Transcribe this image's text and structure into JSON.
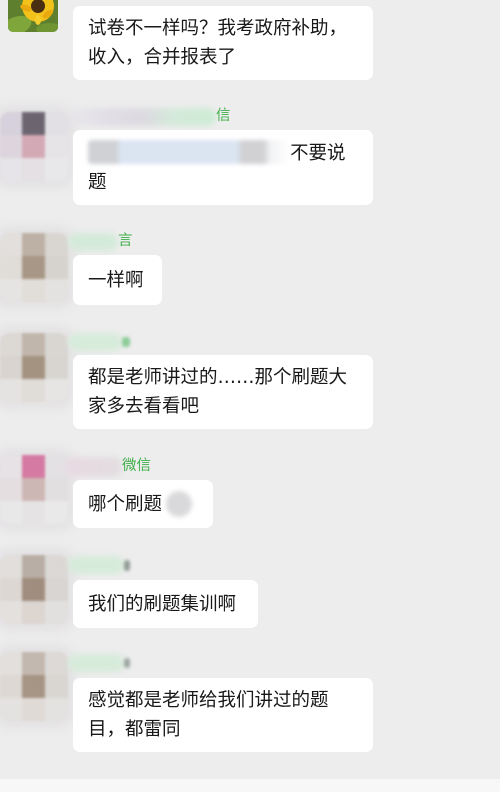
{
  "theme": {
    "background": "#EDEDED",
    "bubble": "#FFFFFF",
    "text": "#191919",
    "sender_tag": "#3FAE49",
    "bottom_bar": "#F7F7F7"
  },
  "messages": [
    {
      "lines": [
        "试卷不一样吗？我考政府补助，",
        "收入，合并报表了"
      ]
    },
    {
      "sender_tag": "信",
      "avatar_tiles": [
        "#D6D1DC",
        "#6C6570",
        "#E2E0E5",
        "#DDD4DD",
        "#D3A9B5",
        "#E6E4E7",
        "#E6E4E8",
        "#E4E0E3",
        "#E8E8EA"
      ],
      "lines": [
        "不要说",
        "题"
      ]
    },
    {
      "sender_tag": "言",
      "avatar_tiles": [
        "#E2DFDC",
        "#BDB1A6",
        "#D9D5D0",
        "#E0DCD8",
        "#A89786",
        "#D6D2CD",
        "#E6E4E2",
        "#E1DDD9",
        "#E4E2E0"
      ],
      "lines": [
        "一样啊"
      ]
    },
    {
      "avatar_tiles": [
        "#DCD8D4",
        "#C1B6AC",
        "#D9D6D2",
        "#D9D4CF",
        "#A49381",
        "#D8D5D1",
        "#E5E3E1",
        "#E0DCD8",
        "#E6E5E3"
      ],
      "lines": [
        "都是老师讲过的……那个刷题大",
        "家多去看看吧"
      ]
    },
    {
      "sender_tag": "微信",
      "avatar_tiles": [
        "#E6E2E5",
        "#D57AA2",
        "#E4E1E4",
        "#E4DEE0",
        "#CDB7B4",
        "#E1DFE0",
        "#E9E8E9",
        "#E6E3E4",
        "#E9E9EA"
      ],
      "lines": [
        "哪个刷题"
      ]
    },
    {
      "avatar_tiles": [
        "#E1DEDB",
        "#B9AEA5",
        "#DBD8D5",
        "#DCD7D3",
        "#A08D7E",
        "#D9D5D2",
        "#E3E0DE",
        "#DCD5D0",
        "#E2E0DE"
      ],
      "lines": [
        "我们的刷题集训啊"
      ]
    },
    {
      "avatar_tiles": [
        "#E2DFDC",
        "#C3B8AF",
        "#DCD9D6",
        "#DDD8D4",
        "#A69484",
        "#D9D6D2",
        "#E4E2E0",
        "#E0DAD6",
        "#E3E2E0"
      ],
      "lines": [
        "感觉都是老师给我们讲过的题",
        "目，都雷同"
      ]
    }
  ]
}
